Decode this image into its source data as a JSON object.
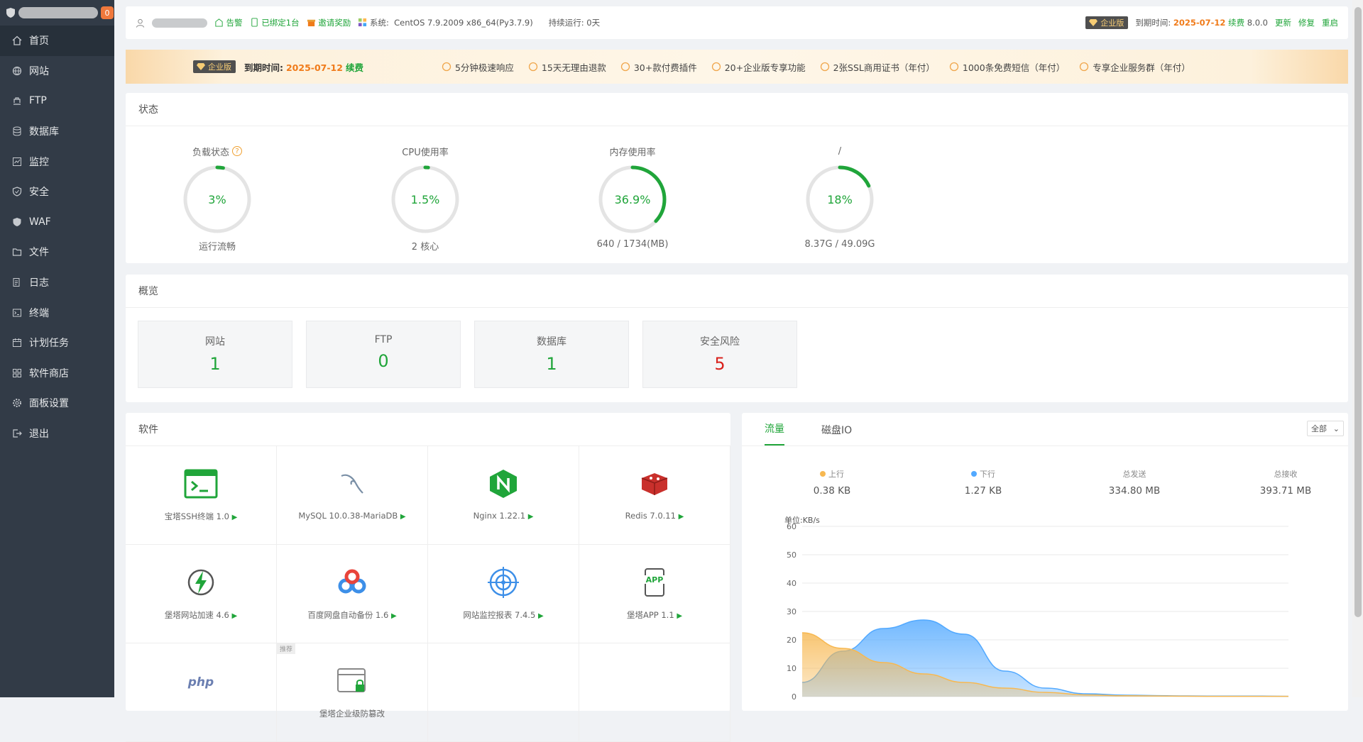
{
  "sidebar": {
    "notify_count": "0",
    "items": [
      {
        "label": "首页",
        "icon": "home-icon"
      },
      {
        "label": "网站",
        "icon": "globe-icon"
      },
      {
        "label": "FTP",
        "icon": "ftp-icon"
      },
      {
        "label": "数据库",
        "icon": "database-icon"
      },
      {
        "label": "监控",
        "icon": "monitor-icon"
      },
      {
        "label": "安全",
        "icon": "shield-icon"
      },
      {
        "label": "WAF",
        "icon": "waf-icon"
      },
      {
        "label": "文件",
        "icon": "folder-icon"
      },
      {
        "label": "日志",
        "icon": "log-icon"
      },
      {
        "label": "终端",
        "icon": "terminal-icon"
      },
      {
        "label": "计划任务",
        "icon": "calendar-icon"
      },
      {
        "label": "软件商店",
        "icon": "apps-icon"
      },
      {
        "label": "面板设置",
        "icon": "gear-icon"
      },
      {
        "label": "退出",
        "icon": "logout-icon"
      }
    ]
  },
  "topbar": {
    "alarm": "告警",
    "bound": "已绑定1台",
    "invite": "邀请奖励",
    "system_label": "系统:",
    "system_value": "CentOS 7.9.2009 x86_64(Py3.7.9)",
    "uptime": "持续运行: 0天",
    "edition": "企业版",
    "expire_label": "到期时间:",
    "expire_date": "2025-07-12",
    "renew": "续费",
    "version": "8.0.0",
    "update": "更新",
    "repair": "修复",
    "restart": "重启"
  },
  "banner": {
    "edition": "企业版",
    "expire_label": "到期时间:",
    "expire_date": "2025-07-12",
    "renew": "续费",
    "features": [
      "5分钟极速响应",
      "15天无理由退款",
      "30+款付费插件",
      "20+企业版专享功能",
      "2张SSL商用证书（年付）",
      "1000条免费短信（年付）",
      "专享企业服务群（年付）"
    ]
  },
  "status": {
    "title": "状态",
    "gauges": [
      {
        "label": "负载状态",
        "value": "3%",
        "percent": 3,
        "sub": "运行流畅",
        "help": true
      },
      {
        "label": "CPU使用率",
        "value": "1.5%",
        "percent": 1.5,
        "sub": "2 核心"
      },
      {
        "label": "内存使用率",
        "value": "36.9%",
        "percent": 36.9,
        "sub": "640 / 1734(MB)"
      },
      {
        "label": "/",
        "value": "18%",
        "percent": 18,
        "sub": "8.37G / 49.09G"
      }
    ]
  },
  "overview": {
    "title": "概览",
    "items": [
      {
        "label": "网站",
        "value": "1"
      },
      {
        "label": "FTP",
        "value": "0"
      },
      {
        "label": "数据库",
        "value": "1"
      },
      {
        "label": "安全风险",
        "value": "5"
      }
    ]
  },
  "software": {
    "title": "软件",
    "recommend": "推荐",
    "items": [
      {
        "name": "宝塔SSH终端 1.0",
        "icon": "ssh-terminal-icon"
      },
      {
        "name": "MySQL 10.0.38-MariaDB",
        "icon": "mysql-icon"
      },
      {
        "name": "Nginx 1.22.1",
        "icon": "nginx-icon"
      },
      {
        "name": "Redis 7.0.11",
        "icon": "redis-icon"
      },
      {
        "name": "堡塔网站加速 4.6",
        "icon": "site-accelerate-icon"
      },
      {
        "name": "百度网盘自动备份 1.6",
        "icon": "baidu-netdisk-icon"
      },
      {
        "name": "网站监控报表 7.4.5",
        "icon": "site-monitor-icon"
      },
      {
        "name": "堡塔APP 1.1",
        "icon": "app-icon"
      },
      {
        "name": "",
        "icon": "php-icon"
      },
      {
        "name": "堡塔企业级防篡改",
        "icon": "tamper-proof-icon"
      }
    ]
  },
  "traffic": {
    "tabs": [
      "流量",
      "磁盘IO"
    ],
    "select": "全部",
    "stats": [
      {
        "label": "上行",
        "value": "0.38 KB",
        "color": "#f7b851"
      },
      {
        "label": "下行",
        "value": "1.27 KB",
        "color": "#52a9ff"
      },
      {
        "label": "总发送",
        "value": "334.80 MB"
      },
      {
        "label": "总接收",
        "value": "393.71 MB"
      }
    ]
  },
  "chart_data": {
    "type": "area",
    "ylabel": "单位:KB/s",
    "ylim": [
      0,
      60
    ],
    "yticks": [
      0,
      10,
      20,
      30,
      40,
      50,
      60
    ],
    "x": [
      0,
      1,
      2,
      3,
      4,
      5,
      6,
      7,
      8,
      9,
      10,
      11,
      12
    ],
    "series": [
      {
        "name": "上行",
        "color": "#f7b851",
        "values": [
          22.5,
          17,
          12,
          8,
          5,
          3,
          1.5,
          0.6,
          0.3,
          0.2,
          0.1,
          0.1,
          0.1
        ]
      },
      {
        "name": "下行",
        "color": "#52a9ff",
        "values": [
          5,
          16,
          24,
          27,
          22,
          9,
          3,
          1,
          0.5,
          0.3,
          0.2,
          0.2,
          0.1
        ]
      }
    ]
  }
}
